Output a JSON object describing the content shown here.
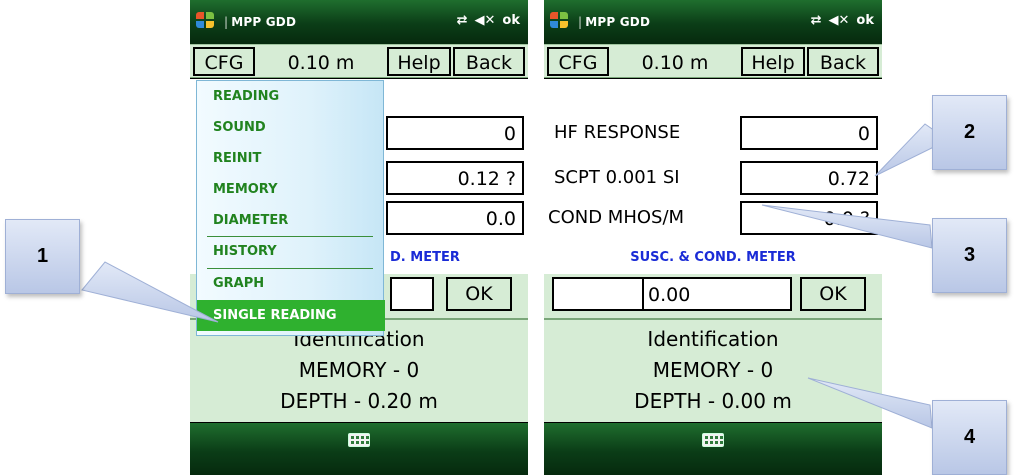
{
  "title_bar": {
    "app_title": "MPP GDD",
    "ok_label": "ok",
    "sync_icon": "sync-icon",
    "volume_icon": "mute-icon"
  },
  "menu_bar": {
    "cfg": "CFG",
    "scale": "0.10 m",
    "help": "Help",
    "back": "Back"
  },
  "left_screen": {
    "fields": [
      {
        "value": "0"
      },
      {
        "value": "0.12 ?"
      },
      {
        "value": "0.0"
      }
    ],
    "meter_label_partial": "D.  METER",
    "ok_button": "OK",
    "info": {
      "identification": "Identification",
      "memory": "MEMORY - 0",
      "depth": "DEPTH - 0.20 m"
    }
  },
  "cfg_dropdown": {
    "items": [
      "READING",
      "SOUND",
      "REINIT",
      "MEMORY",
      "DIAMETER",
      "HISTORY",
      "GRAPH",
      "SINGLE READING"
    ],
    "selected": "SINGLE READING"
  },
  "right_screen": {
    "fields": [
      {
        "label": "HF  RESPONSE",
        "value": "0"
      },
      {
        "label": "SCPT  0.001 SI",
        "value": "0.72"
      },
      {
        "label": "COND MHOS/M",
        "value": "0.0 ?"
      }
    ],
    "meter_label": "SUSC. & COND.  METER",
    "input_value": "0.00",
    "ok_button": "OK",
    "info": {
      "identification": "Identification",
      "memory": "MEMORY - 0",
      "depth": "DEPTH - 0.00 m"
    }
  },
  "callouts": [
    "1",
    "2",
    "3",
    "4"
  ],
  "colors": {
    "title_bar": "#0b3d17",
    "panel": "#d6ecd5",
    "menu_text": "#21831f",
    "menu_selected": "#2fb12f",
    "meter_label": "#1a2bd6",
    "callout": "#c9d5ee"
  }
}
